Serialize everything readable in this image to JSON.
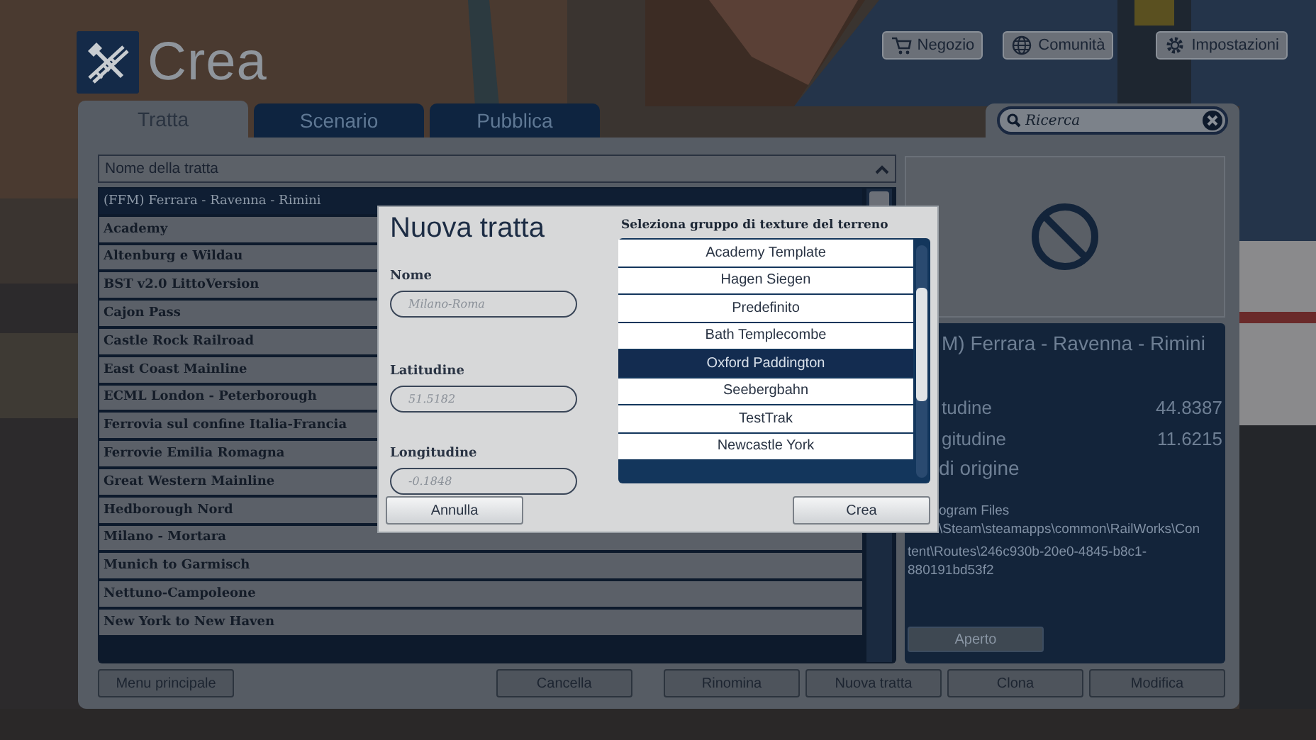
{
  "header": {
    "title": "Crea"
  },
  "top_buttons": [
    {
      "label": "Negozio",
      "kind": "cart"
    },
    {
      "label": "Comunità",
      "kind": "globe"
    },
    {
      "label": "Impostazioni",
      "kind": "gear"
    }
  ],
  "tabs": [
    {
      "label": "Tratta",
      "selected": true
    },
    {
      "label": "Scenario",
      "selected": false
    },
    {
      "label": "Pubblica",
      "selected": false
    }
  ],
  "search": {
    "placeholder": "Ricerca"
  },
  "route_list": {
    "header": "Nome della tratta",
    "rows": [
      {
        "name": "(FFM) Ferrara - Ravenna - Rimini",
        "selected": true
      },
      {
        "name": "Academy",
        "selected": false
      },
      {
        "name": "Altenburg e Wildau",
        "selected": false
      },
      {
        "name": "BST v2.0 LittoVersion",
        "selected": false
      },
      {
        "name": "Cajon Pass",
        "selected": false
      },
      {
        "name": "Castle Rock Railroad",
        "selected": false
      },
      {
        "name": "East Coast Mainline",
        "selected": false
      },
      {
        "name": "ECML London - Peterborough",
        "selected": false
      },
      {
        "name": "Ferrovia sul confine Italia-Francia",
        "selected": false
      },
      {
        "name": "Ferrovie Emilia Romagna",
        "selected": false
      },
      {
        "name": "Great Western Mainline",
        "selected": false
      },
      {
        "name": "Hedborough Nord",
        "selected": false
      },
      {
        "name": "Milano - Mortara",
        "selected": false
      },
      {
        "name": "Munich to Garmisch",
        "selected": false
      },
      {
        "name": "Nettuno-Campoleone",
        "selected": false
      },
      {
        "name": "New York to New Haven",
        "selected": false
      }
    ]
  },
  "details": {
    "title": "M) Ferrara - Ravenna - Rimini",
    "rows": [
      {
        "label": "tudine",
        "value": "44.8387"
      },
      {
        "label": "gitudine",
        "value": "11.6215"
      }
    ],
    "origin_label": "di origine",
    "path_partial_lines": [
      "ogram Files",
      "\\Steam\\steamapps\\common\\RailWorks\\Con"
    ],
    "path_lines": [
      "tent\\Routes\\246c930b-20e0-4845-b8c1-",
      "880191bd53f2"
    ],
    "open_button": {
      "label": "Aperto",
      "disabled": true
    }
  },
  "bottom_buttons": {
    "left": [
      "Menu principale"
    ],
    "middle": [
      "Cancella"
    ],
    "right": [
      "Rinomina",
      "Nuova tratta",
      "Clona",
      "Modifica"
    ]
  },
  "dialog": {
    "title": "Nuova tratta",
    "fields": [
      {
        "label": "Nome",
        "placeholder": "Milano-Roma"
      },
      {
        "label": "Latitudine",
        "placeholder": "51.5182"
      },
      {
        "label": "Longitudine",
        "placeholder": "-0.1848"
      }
    ],
    "texture_label": "Seleziona gruppo di texture del terreno",
    "textures": [
      {
        "name": "Academy Template",
        "selected": false
      },
      {
        "name": "Hagen Siegen",
        "selected": false
      },
      {
        "name": "Predefinito",
        "selected": false
      },
      {
        "name": "Bath Templecombe",
        "selected": false
      },
      {
        "name": "Oxford Paddington",
        "selected": true
      },
      {
        "name": "Seebergbahn",
        "selected": false
      },
      {
        "name": "TestTrak",
        "selected": false
      },
      {
        "name": "Newcastle York",
        "selected": false
      }
    ],
    "buttons": [
      "Annulla",
      "Crea"
    ]
  }
}
